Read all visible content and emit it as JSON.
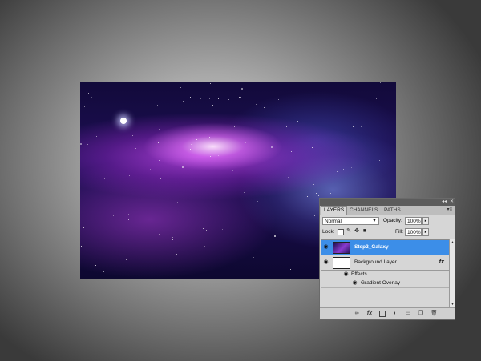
{
  "panel": {
    "tabs": [
      {
        "label": "LAYERS",
        "active": true
      },
      {
        "label": "CHANNELS",
        "active": false
      },
      {
        "label": "PATHS",
        "active": false
      }
    ],
    "blend_mode": "Normal",
    "opacity_label": "Opacity:",
    "opacity_value": "100%",
    "lock_label": "Lock:",
    "fill_label": "Fill:",
    "fill_value": "100%",
    "layers": [
      {
        "name": "Step2_Galaxy",
        "selected": true
      },
      {
        "name": "Background Layer",
        "selected": false,
        "fx": "fx"
      }
    ],
    "effects_label": "Effects",
    "effect_item": "Gradient Overlay",
    "icons": [
      "link-icon",
      "fx-icon",
      "mask-icon",
      "adjustment-icon",
      "folder-icon",
      "new-layer-icon",
      "trash-icon"
    ]
  },
  "colors": {
    "selection": "#3c8ee8",
    "panel_bg": "#d6d6d6",
    "titlebar": "#5c5c5c"
  }
}
